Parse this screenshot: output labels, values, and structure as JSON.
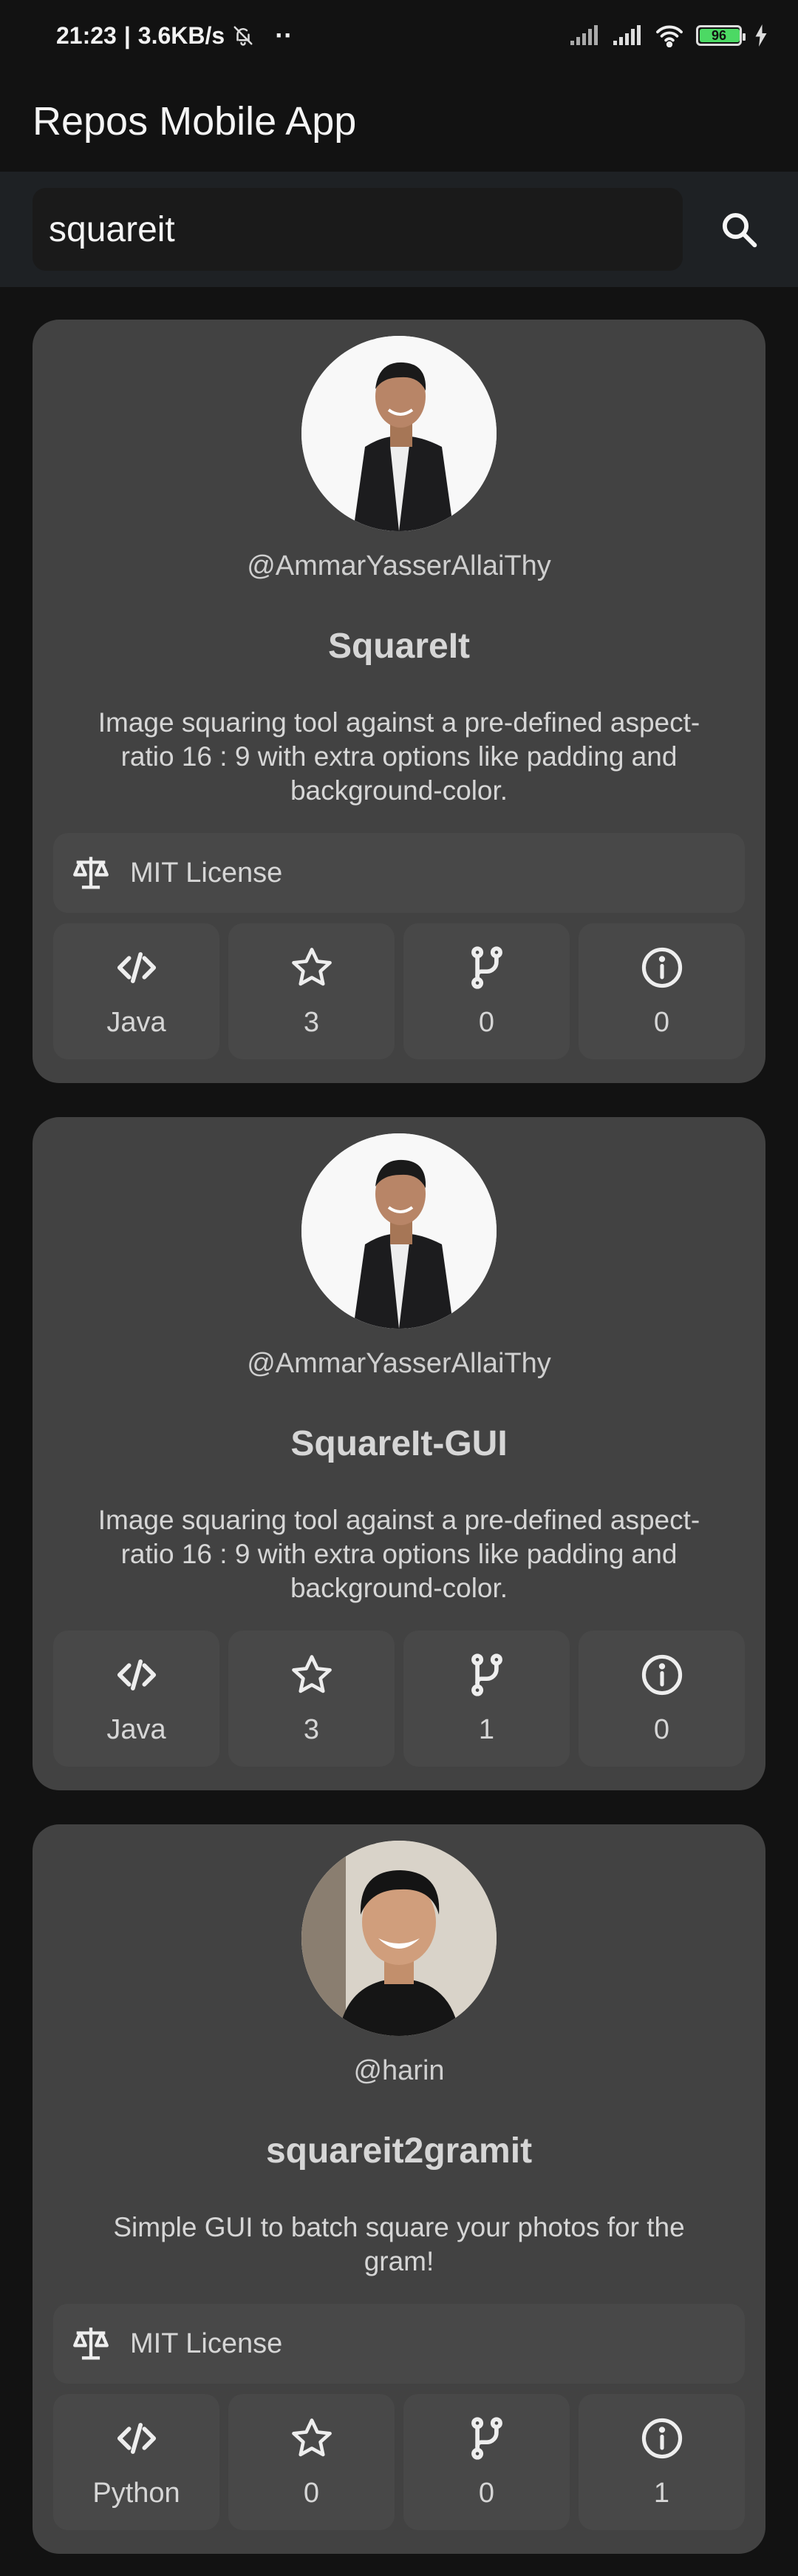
{
  "status_bar": {
    "time": "21:23",
    "speed": "3.6KB/s",
    "dots": "··",
    "battery": "96",
    "battery_level": 0.96
  },
  "app_bar": {
    "title": "Repos Mobile App"
  },
  "search": {
    "value": "squareit",
    "placeholder": ""
  },
  "repos": [
    {
      "username": "@AmmarYasserAllaiThy",
      "name": "SquareIt",
      "description": "Image squaring tool against a pre-defined aspect-ratio 16 : 9 with extra options like padding and background-color.",
      "license": "MIT License",
      "language": "Java",
      "stars": "3",
      "forks": "0",
      "issues": "0"
    },
    {
      "username": "@AmmarYasserAllaiThy",
      "name": "SquareIt-GUI",
      "description": "Image squaring tool against a pre-defined aspect-ratio 16 : 9 with extra options like padding and background-color.",
      "license": "",
      "language": "Java",
      "stars": "3",
      "forks": "1",
      "issues": "0"
    },
    {
      "username": "@harin",
      "name": "squareit2gramit",
      "description": "Simple GUI to batch square your photos for the gram!",
      "license": "MIT License",
      "language": "Python",
      "stars": "0",
      "forks": "0",
      "issues": "1"
    }
  ],
  "icons": {
    "search": "search-icon",
    "license": "scale-icon",
    "language": "code-icon",
    "stars": "star-icon",
    "forks": "fork-icon",
    "issues": "info-icon"
  }
}
